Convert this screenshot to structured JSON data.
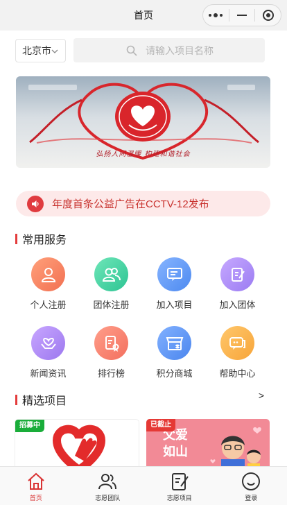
{
  "nav": {
    "title": "首页",
    "capsule": {
      "more_icon": "more-dots-icon",
      "minimize_icon": "minimize-icon",
      "close_icon": "target-close-icon"
    }
  },
  "search_bar": {
    "city": "北京市",
    "placeholder": "请输入项目名称",
    "value": ""
  },
  "banner": {
    "slogan": "弘扬人间温暖 构建和谐社会"
  },
  "notice": {
    "icon": "speaker-icon",
    "text": "年度首条公益广告在CCTV-12发布"
  },
  "services": {
    "title": "常用服务",
    "items": [
      {
        "label": "个人注册",
        "icon": "person-icon",
        "color_from": "#ffa07a",
        "color_to": "#f27052"
      },
      {
        "label": "团体注册",
        "icon": "group-icon",
        "color_from": "#6ee6b8",
        "color_to": "#2dc493"
      },
      {
        "label": "加入项目",
        "icon": "project-icon",
        "color_from": "#86b4ff",
        "color_to": "#4d8af0"
      },
      {
        "label": "加入团体",
        "icon": "edit-doc-icon",
        "color_from": "#c6a8ff",
        "color_to": "#9b7cf2"
      },
      {
        "label": "新闻资讯",
        "icon": "heart-hands-icon",
        "color_from": "#c8a6ff",
        "color_to": "#9c78ef"
      },
      {
        "label": "排行榜",
        "icon": "ranking-icon",
        "color_from": "#ff9e8a",
        "color_to": "#f36f5e"
      },
      {
        "label": "积分商城",
        "icon": "shop-icon",
        "color_from": "#82b1ff",
        "color_to": "#4b86ee"
      },
      {
        "label": "帮助中心",
        "icon": "chat-help-icon",
        "color_from": "#ffc76b",
        "color_to": "#f7a53a"
      }
    ]
  },
  "featured": {
    "title": "精选项目",
    "more": ">",
    "cards": [
      {
        "tag": "招募中",
        "tag_color": "#1aad3a"
      },
      {
        "tag": "已截止",
        "tag_color": "#e53935",
        "text_line1": "父爱",
        "text_line2": "如山"
      }
    ]
  },
  "tabbar": {
    "items": [
      {
        "label": "首页",
        "icon": "home-icon",
        "active": true
      },
      {
        "label": "志愿团队",
        "icon": "team-icon",
        "active": false
      },
      {
        "label": "志愿项目",
        "icon": "project-edit-icon",
        "active": false
      },
      {
        "label": "登录",
        "icon": "login-icon",
        "active": false
      }
    ]
  },
  "colors": {
    "accent": "#e33b3b",
    "notice_bg": "#fde9e9",
    "notice_text": "#c8312d"
  }
}
